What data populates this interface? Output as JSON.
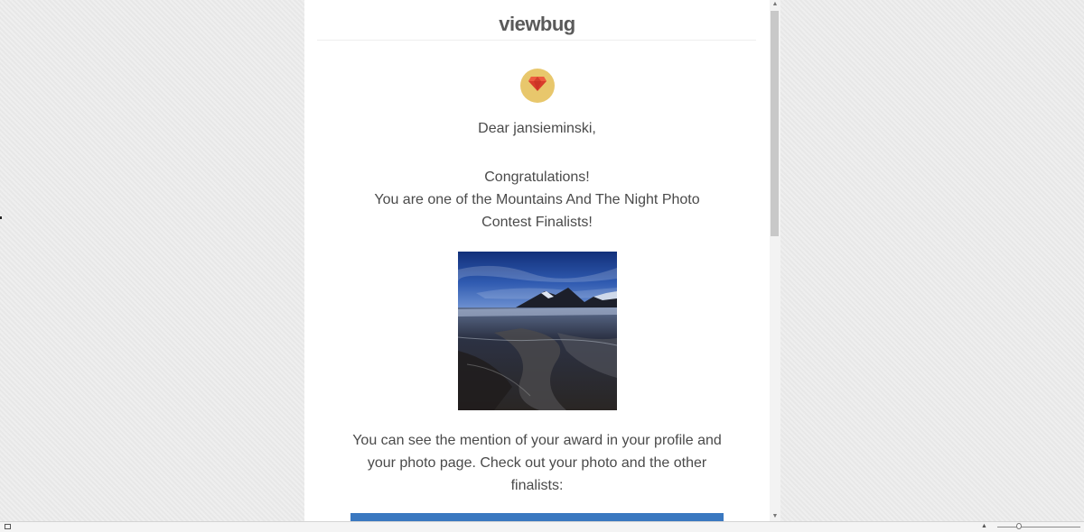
{
  "email": {
    "brand": "viewbug",
    "greeting": "Dear jansieminski,",
    "congrats_line1": "Congratulations!",
    "congrats_line2": "You are one of the Mountains And The Night Photo",
    "congrats_line3": "Contest Finalists!",
    "info_line1": "You can see the mention of your award in your profile and",
    "info_line2": "your photo page. Check out your photo and the other",
    "info_line3": "finalists:",
    "badge_icon": "gem-icon",
    "cta_color": "#3a78c0",
    "badge_color": "#e8c76c",
    "gem_color": "#d93b2b"
  },
  "window": {
    "scroll_up_glyph": "▲",
    "scroll_down_glyph": "▼",
    "zoom_up_glyph": "▲"
  }
}
